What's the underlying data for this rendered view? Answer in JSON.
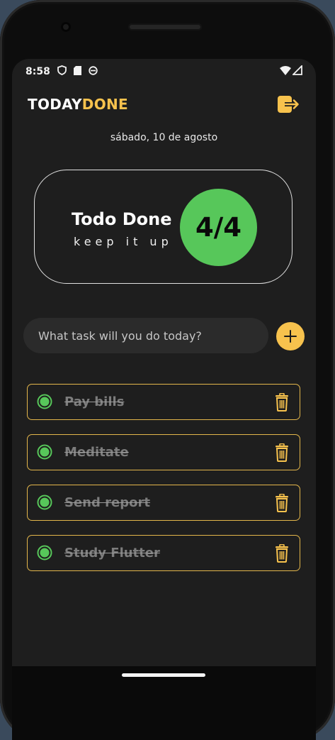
{
  "status_bar": {
    "time": "8:58",
    "icons": [
      "shield-icon",
      "sd-card-icon",
      "sync-icon"
    ],
    "right_icons": [
      "wifi-icon",
      "signal-icon"
    ]
  },
  "app": {
    "title_part1": "TODAY",
    "title_part2": "DONE",
    "accent_color": "#f7c24d",
    "logout_icon": "logout-icon"
  },
  "date": "sábado, 10 de agosto",
  "summary": {
    "title": "Todo Done",
    "subtitle": "keep it up",
    "completed": 4,
    "total": 4,
    "progress_text": "4/4",
    "progress_color": "#57c75a"
  },
  "new_task": {
    "placeholder": "What task will you do today?",
    "value": "",
    "add_icon": "plus-icon"
  },
  "tasks": [
    {
      "label": "Pay bills",
      "done": true
    },
    {
      "label": "Meditate",
      "done": true
    },
    {
      "label": "Send report",
      "done": true
    },
    {
      "label": "Study Flutter",
      "done": true
    }
  ],
  "task_icons": {
    "check": "check-circle-icon",
    "delete": "trash-icon"
  },
  "colors": {
    "background": "#1e1e1e",
    "task_border": "#e3b64b",
    "done_text": "#7d7d7d"
  }
}
